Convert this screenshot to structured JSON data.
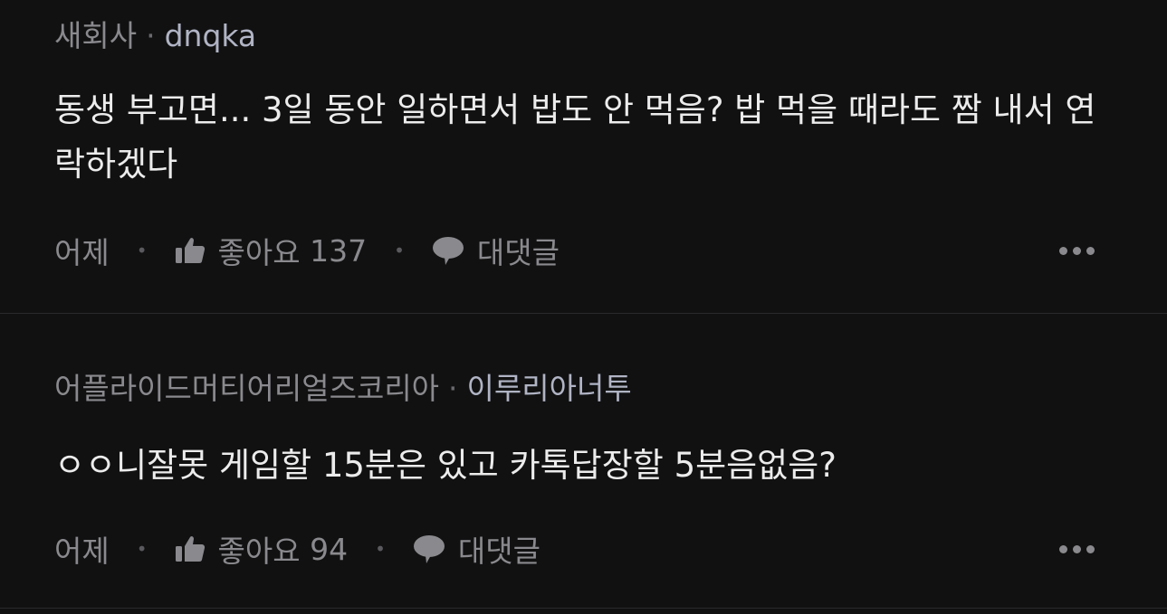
{
  "comments": [
    {
      "company": "새회사",
      "separator": "·",
      "nickname": "dnqka",
      "text": "동생 부고면... 3일 동안 일하면서 밥도 안 먹음? 밥 먹을 때라도 짬 내서 연락하겠다",
      "time": "어제",
      "like_label": "좋아요",
      "like_count": "137",
      "reply_label": "대댓글"
    },
    {
      "company": "어플라이드머티어리얼즈코리아",
      "separator": "·",
      "nickname": "이루리아너투",
      "text": "ㅇㅇ니잘못 게임할 15분은 있고 카톡답장할 5분음없음?",
      "time": "어제",
      "like_label": "좋아요",
      "like_count": "94",
      "reply_label": "대댓글"
    }
  ],
  "icons": {
    "like": "thumbs-up-icon",
    "reply": "speech-bubble-icon",
    "more": "more-dots-icon"
  },
  "colors": {
    "background": "#111112",
    "text_primary": "#ececec",
    "text_secondary": "#8a8a8e",
    "nickname": "#b0b4c4",
    "divider": "#2a2a2c"
  }
}
